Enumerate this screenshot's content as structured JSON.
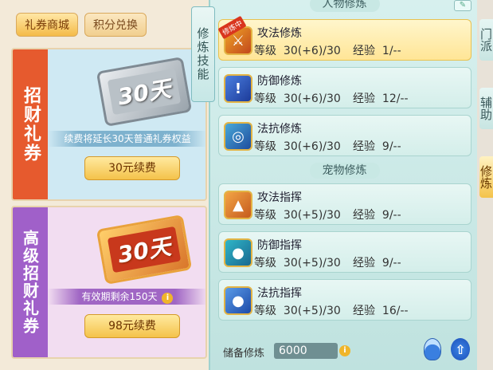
{
  "tabs": [
    {
      "label": "礼券商城",
      "active": true
    },
    {
      "label": "积分兑换",
      "active": false
    }
  ],
  "cards": [
    {
      "title": "招财礼券",
      "coupon_text": "30天",
      "info": "续费将延长30天普通礼券权益",
      "button": "30元续费",
      "info_icon": false
    },
    {
      "title": "高级招财礼券",
      "coupon_text": "30天",
      "info": "有效期剩余150天",
      "button": "98元续费",
      "info_icon": true
    }
  ],
  "side_tab": "修炼技能",
  "sections": {
    "character": "人物修炼",
    "pet": "宠物修炼"
  },
  "character_skills": [
    {
      "name": "攻法修炼",
      "level_label": "等级",
      "level": "30(+6)/30",
      "exp_label": "经验",
      "exp": "1/--",
      "active": true,
      "badge": "修炼中",
      "icon": "crossed-swords-icon"
    },
    {
      "name": "防御修炼",
      "level_label": "等级",
      "level": "30(+6)/30",
      "exp_label": "经验",
      "exp": "12/--",
      "active": false,
      "icon": "shield-icon"
    },
    {
      "name": "法抗修炼",
      "level_label": "等级",
      "level": "30(+6)/30",
      "exp_label": "经验",
      "exp": "9/--",
      "active": false,
      "icon": "magic-shield-icon"
    }
  ],
  "pet_skills": [
    {
      "name": "攻法指挥",
      "level_label": "等级",
      "level": "30(+5)/30",
      "exp_label": "经验",
      "exp": "9/--",
      "icon": "paw-attack-icon"
    },
    {
      "name": "防御指挥",
      "level_label": "等级",
      "level": "30(+5)/30",
      "exp_label": "经验",
      "exp": "9/--",
      "icon": "paw-defense-icon"
    },
    {
      "name": "法抗指挥",
      "level_label": "等级",
      "level": "30(+5)/30",
      "exp_label": "经验",
      "exp": "16/--",
      "icon": "paw-resist-icon"
    }
  ],
  "reserve": {
    "label": "储备修炼",
    "value": "6000"
  },
  "far_tabs": [
    {
      "label": "门派",
      "active": false
    },
    {
      "label": "辅助",
      "active": false
    },
    {
      "label": "修炼",
      "active": true
    }
  ],
  "colors": {
    "card1_accent": "#e65a2e",
    "card2_accent": "#a060c9",
    "active_skill_bg": "#ffe596"
  }
}
